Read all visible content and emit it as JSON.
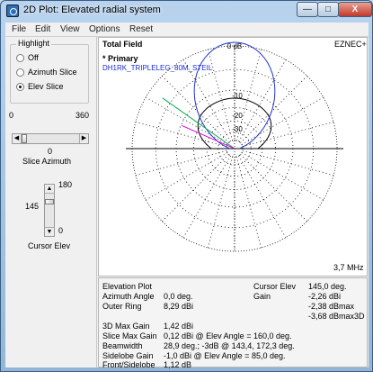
{
  "window": {
    "title": "2D Plot: Elevated radial system",
    "min_glyph": "—",
    "max_glyph": "□",
    "close_glyph": "X"
  },
  "menu": [
    "File",
    "Edit",
    "View",
    "Options",
    "Reset"
  ],
  "highlight": {
    "group_label": "Highlight",
    "options": [
      {
        "label": "Off",
        "selected": false
      },
      {
        "label": "Azimuth Slice",
        "selected": false
      },
      {
        "label": "Elev Slice",
        "selected": true
      }
    ]
  },
  "slice_azimuth": {
    "min": "0",
    "max": "360",
    "value": "0",
    "caption": "Slice Azimuth",
    "value_num": 0,
    "range": [
      0,
      360
    ]
  },
  "cursor_elev": {
    "max": "180",
    "min": "0",
    "value": "145",
    "caption": "Cursor Elev",
    "value_num": 145,
    "range": [
      0,
      180
    ]
  },
  "plot": {
    "field_label": "Total Field",
    "program": "EZNEC+",
    "trace_label": "* Primary",
    "file_name": "DH1RK_TRIPLELEG_80M_STEIL",
    "ring_labels": [
      "0 dB",
      "-10",
      "-20",
      "-30"
    ],
    "frequency": "3,7 MHz",
    "colors": {
      "primary_trace": "#000000",
      "highlight_slice": "#2233dd",
      "cursor_line": "#00b050",
      "cursor_line2": "#dd00dd",
      "grid": "#000000"
    }
  },
  "info": {
    "rows_left": [
      {
        "label": "Elevation Plot",
        "value": ""
      },
      {
        "label": "Azimuth Angle",
        "value": "0,0 deg."
      },
      {
        "label": "Outer Ring",
        "value": "8,29 dBi"
      },
      {
        "label": "3D Max Gain",
        "value": "1,42 dBi"
      },
      {
        "label": "Slice Max Gain",
        "value": "0,12 dBi @ Elev Angle = 160,0 deg."
      },
      {
        "label": "Beamwidth",
        "value": "28,9 deg.; -3dB @ 143,4, 172,3 deg."
      },
      {
        "label": "Sidelobe Gain",
        "value": "-1,0 dBi @ Elev Angle = 85,0 deg."
      },
      {
        "label": "Front/Sidelobe",
        "value": "1,12 dB"
      }
    ],
    "cursor": {
      "elev_label": "Cursor Elev",
      "elev_value": "145,0 deg.",
      "gain_label": "Gain",
      "gain_dbi": "-2,26 dBi",
      "gain_dbmax": "-2,38 dBmax",
      "gain_dbmax3d": "-3,68 dBmax3D"
    }
  }
}
